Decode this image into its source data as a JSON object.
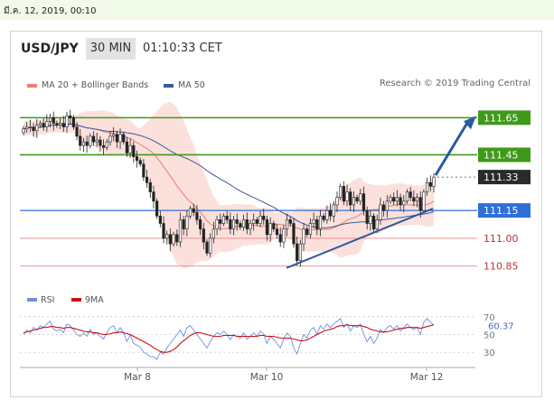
{
  "header": {
    "datetime": "มี.ค. 12, 2019, 00:10",
    "pair": "USD/JPY",
    "timeframe": "30 MIN",
    "time": "01:10:33 CET",
    "credit": "Research © 2019 Trading Central"
  },
  "colors": {
    "resistance": "#3f9a1a",
    "pivot": "#2e6fd8",
    "support": "#e98585",
    "bollinger": "#f7c6c0",
    "ma20": "#e88070",
    "ma50": "#3a5a9a",
    "rsi": "#6f8fe0",
    "rsi_ma": "#cc1010",
    "arrow": "#2c5aa0",
    "last_price": "#2a2a2a"
  },
  "chart_data": [
    {
      "type": "candlestick",
      "legend": [
        {
          "name": "MA 20 + Bollinger Bands",
          "color": "#e88070"
        },
        {
          "name": "MA 50",
          "color": "#3a5a9a"
        }
      ],
      "x_ticks": [
        "Mar 8",
        "Mar 10",
        "Mar 12"
      ],
      "ylim": [
        110.8,
        111.72
      ],
      "levels": [
        {
          "label": "111.65",
          "value": 111.65,
          "kind": "resistance"
        },
        {
          "label": "111.45",
          "value": 111.45,
          "kind": "resistance"
        },
        {
          "label": "111.33",
          "value": 111.33,
          "kind": "last"
        },
        {
          "label": "111.15",
          "value": 111.15,
          "kind": "pivot"
        },
        {
          "label": "111.00",
          "value": 111.0,
          "kind": "support"
        },
        {
          "label": "110.85",
          "value": 110.85,
          "kind": "support"
        }
      ],
      "last_price": 111.33,
      "close": [
        111.59,
        111.6,
        111.6,
        111.58,
        111.61,
        111.62,
        111.6,
        111.63,
        111.65,
        111.62,
        111.61,
        111.62,
        111.6,
        111.66,
        111.65,
        111.6,
        111.55,
        111.5,
        111.52,
        111.5,
        111.55,
        111.52,
        111.53,
        111.5,
        111.49,
        111.52,
        111.55,
        111.56,
        111.52,
        111.56,
        111.52,
        111.46,
        111.5,
        111.44,
        111.42,
        111.4,
        111.33,
        111.3,
        111.25,
        111.2,
        111.12,
        111.08,
        111.0,
        111.02,
        110.97,
        111.02,
        110.98,
        111.1,
        111.05,
        111.12,
        111.16,
        111.14,
        111.1,
        111.05,
        110.98,
        110.92,
        111.0,
        111.05,
        111.1,
        111.08,
        111.12,
        111.1,
        111.05,
        111.1,
        111.08,
        111.06,
        111.1,
        111.05,
        111.08,
        111.1,
        111.08,
        111.12,
        111.1,
        111.02,
        111.08,
        111.05,
        111.02,
        110.98,
        111.05,
        111.1,
        111.08,
        110.97,
        110.88,
        110.97,
        111.05,
        111.02,
        111.08,
        111.1,
        111.05,
        111.12,
        111.1,
        111.15,
        111.12,
        111.18,
        111.22,
        111.28,
        111.2,
        111.25,
        111.18,
        111.22,
        111.2,
        111.24,
        111.15,
        111.08,
        111.12,
        111.05,
        111.1,
        111.18,
        111.15,
        111.2,
        111.22,
        111.2,
        111.22,
        111.18,
        111.2,
        111.25,
        111.22,
        111.2,
        111.22,
        111.15,
        111.25,
        111.3,
        111.28,
        111.33
      ]
    },
    {
      "type": "line",
      "legend": [
        {
          "name": "RSI",
          "color": "#6f8fe0"
        },
        {
          "name": "9MA",
          "color": "#cc1010"
        }
      ],
      "ylim": [
        20,
        75
      ],
      "y_ticks": [
        70,
        50,
        30
      ],
      "rsi_value_label": "60.37",
      "rsi": [
        50,
        55,
        52,
        58,
        55,
        60,
        58,
        62,
        65,
        56,
        54,
        56,
        52,
        62,
        60,
        55,
        50,
        48,
        52,
        48,
        56,
        50,
        52,
        48,
        45,
        52,
        58,
        60,
        52,
        58,
        52,
        42,
        50,
        40,
        38,
        36,
        30,
        28,
        25,
        25,
        22,
        30,
        28,
        35,
        40,
        45,
        50,
        55,
        48,
        58,
        60,
        55,
        50,
        45,
        40,
        35,
        42,
        48,
        52,
        50,
        54,
        50,
        44,
        50,
        48,
        46,
        52,
        45,
        48,
        52,
        48,
        54,
        50,
        40,
        48,
        45,
        40,
        35,
        45,
        52,
        48,
        35,
        28,
        40,
        50,
        46,
        55,
        58,
        50,
        60,
        56,
        62,
        58,
        62,
        65,
        68,
        58,
        62,
        54,
        60,
        58,
        62,
        50,
        42,
        48,
        40,
        46,
        56,
        52,
        58,
        60,
        56,
        60,
        54,
        58,
        62,
        58,
        56,
        58,
        50,
        64,
        68,
        64,
        60.37
      ],
      "ma9": [
        52,
        53,
        54,
        55,
        56,
        57,
        58,
        58,
        59,
        59,
        58,
        58,
        57,
        58,
        58,
        57,
        56,
        55,
        54,
        53,
        53,
        52,
        52,
        51,
        50,
        50,
        51,
        52,
        52,
        53,
        52,
        51,
        50,
        48,
        46,
        44,
        42,
        40,
        38,
        35,
        33,
        31,
        30,
        30,
        31,
        33,
        36,
        40,
        43,
        46,
        49,
        51,
        52,
        52,
        51,
        50,
        49,
        48,
        48,
        48,
        49,
        49,
        49,
        49,
        48,
        48,
        48,
        48,
        48,
        48,
        48,
        49,
        49,
        48,
        48,
        48,
        47,
        46,
        46,
        46,
        46,
        45,
        44,
        43,
        43,
        44,
        46,
        48,
        50,
        52,
        54,
        55,
        56,
        57,
        59,
        60,
        60,
        61,
        60,
        60,
        60,
        60,
        59,
        58,
        56,
        55,
        54,
        53,
        53,
        53,
        54,
        55,
        56,
        57,
        57,
        58,
        58,
        58,
        58,
        57,
        58,
        59,
        60,
        61
      ]
    }
  ]
}
